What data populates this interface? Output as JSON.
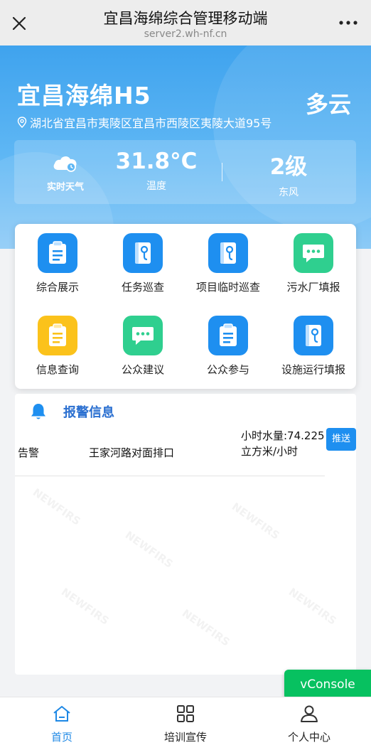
{
  "topbar": {
    "title": "宜昌海绵综合管理移动端",
    "url": "server2.wh-nf.cn"
  },
  "hero": {
    "name": "宜昌海绵H5",
    "weather_text": "多云",
    "address": "湖北省宜昌市夷陵区宜昌市西陵区夷陵大道95号"
  },
  "weather": {
    "realtime_label": "实时天气",
    "temperature": "31.8°C",
    "temperature_label": "温度",
    "wind_level": "2级",
    "wind_dir": "东风"
  },
  "grid": {
    "items": [
      {
        "label": "综合展示",
        "icon": "document-icon"
      },
      {
        "label": "任务巡查",
        "icon": "map-book-icon"
      },
      {
        "label": "项目临时巡查",
        "icon": "map-book-icon"
      },
      {
        "label": "污水厂填报",
        "icon": "chat-icon"
      },
      {
        "label": "信息查询",
        "icon": "document-icon"
      },
      {
        "label": "公众建议",
        "icon": "chat-icon"
      },
      {
        "label": "公众参与",
        "icon": "document-icon"
      },
      {
        "label": "设施运行填报",
        "icon": "map-book-icon"
      }
    ]
  },
  "alarm": {
    "title": "报警信息",
    "rows": [
      {
        "type": "告警",
        "location": "王家河路对面排口",
        "detail": "小时水量:74.225立方米/小时",
        "action": "推送"
      }
    ]
  },
  "vconsole": "vConsole",
  "tabs": [
    {
      "label": "首页",
      "icon": "home-icon"
    },
    {
      "label": "培训宣传",
      "icon": "grid-icon"
    },
    {
      "label": "个人中心",
      "icon": "user-icon"
    }
  ],
  "colors": {
    "accent": "#1e88e5",
    "blue_tile": "#1e8ff0",
    "green_tile": "#2fcf8f",
    "yellow_tile": "#fbc21b"
  }
}
